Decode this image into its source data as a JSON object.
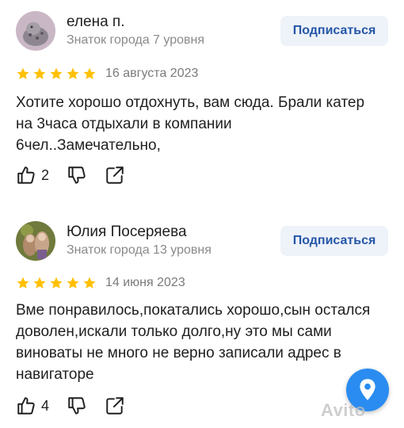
{
  "reviews": [
    {
      "author": "елена п.",
      "level": "Знаток города 7 уровня",
      "subscribe_label": "Подписаться",
      "rating": 5,
      "date": "16 августа 2023",
      "text": "Хотите хорошо отдохнуть, вам сюда. Брали катер\nна 3часа отдыхали в компании\n6чел..Замечательно,",
      "likes": "2"
    },
    {
      "author": "Юлия Посеряева",
      "level": "Знаток города 13 уровня",
      "subscribe_label": "Подписаться",
      "rating": 5,
      "date": "14 июня 2023",
      "text": "Вме понравилось,покатались хорошо,сын остался\nдоволен,искали только долго,ну это мы сами\nвиноваты не много не верно записали адрес в\nнавигаторе",
      "likes": "4"
    }
  ],
  "colors": {
    "star": "#ffc000",
    "accent": "#2557a7",
    "map_button": "#2a8cf0"
  },
  "icons": [
    "like-icon",
    "dislike-icon",
    "share-icon",
    "map-pin-icon"
  ],
  "watermark": "Avito"
}
